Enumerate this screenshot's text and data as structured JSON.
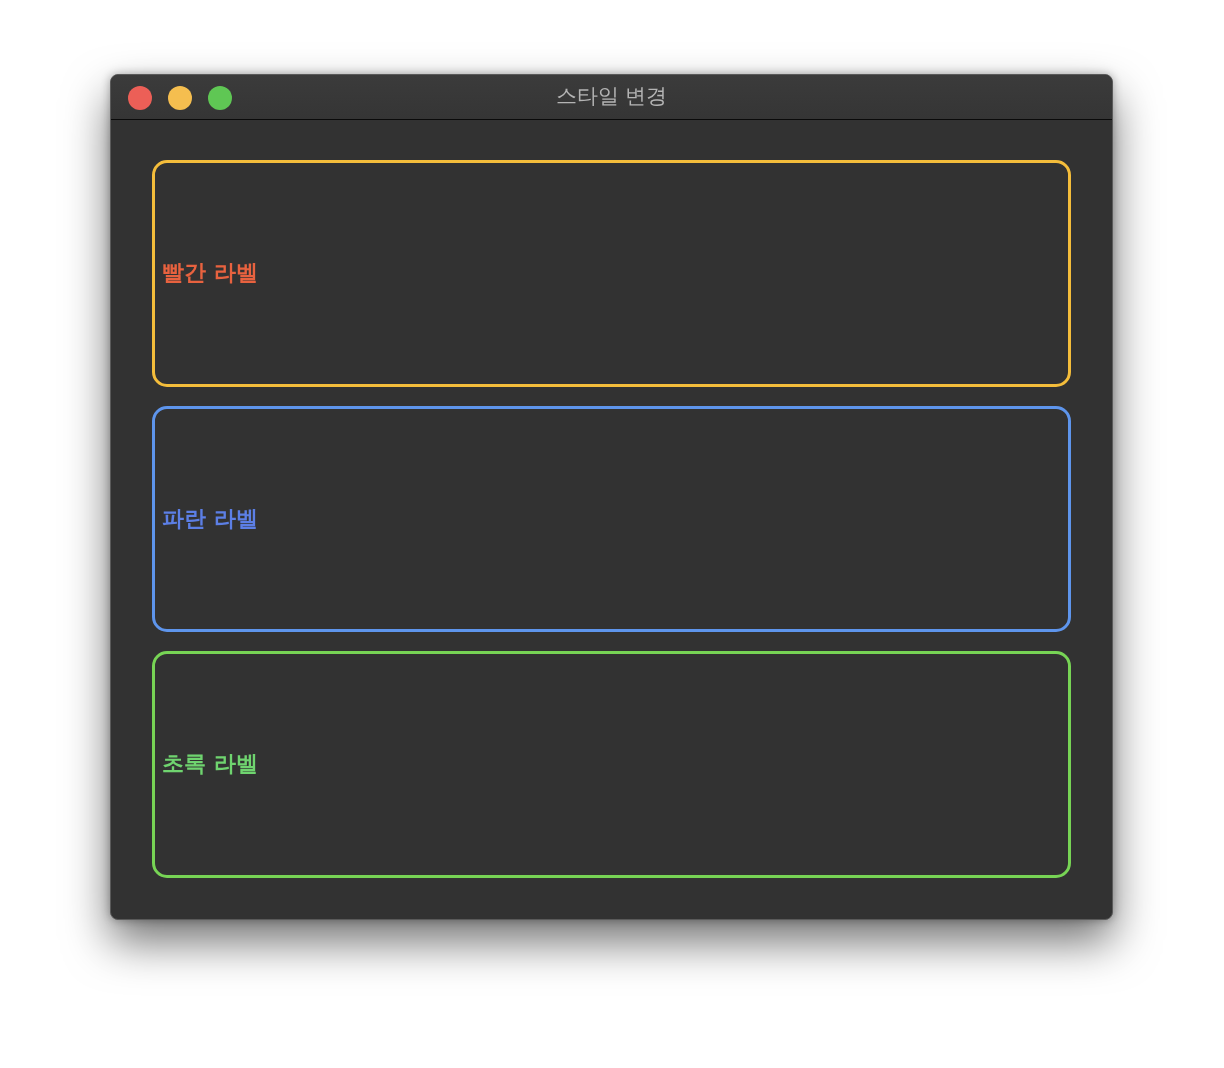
{
  "window": {
    "title": "스타일 변경"
  },
  "panels": [
    {
      "color": "#f4bd3b",
      "label": {
        "text": "빨간 라벨",
        "color": "#e8623f"
      }
    },
    {
      "color": "#5e95ec",
      "label": {
        "text": "파란 라벨",
        "color": "#5c7fe6"
      }
    },
    {
      "color": "#77d455",
      "label": {
        "text": "초록 라벨",
        "color": "#6fd46f"
      }
    }
  ]
}
